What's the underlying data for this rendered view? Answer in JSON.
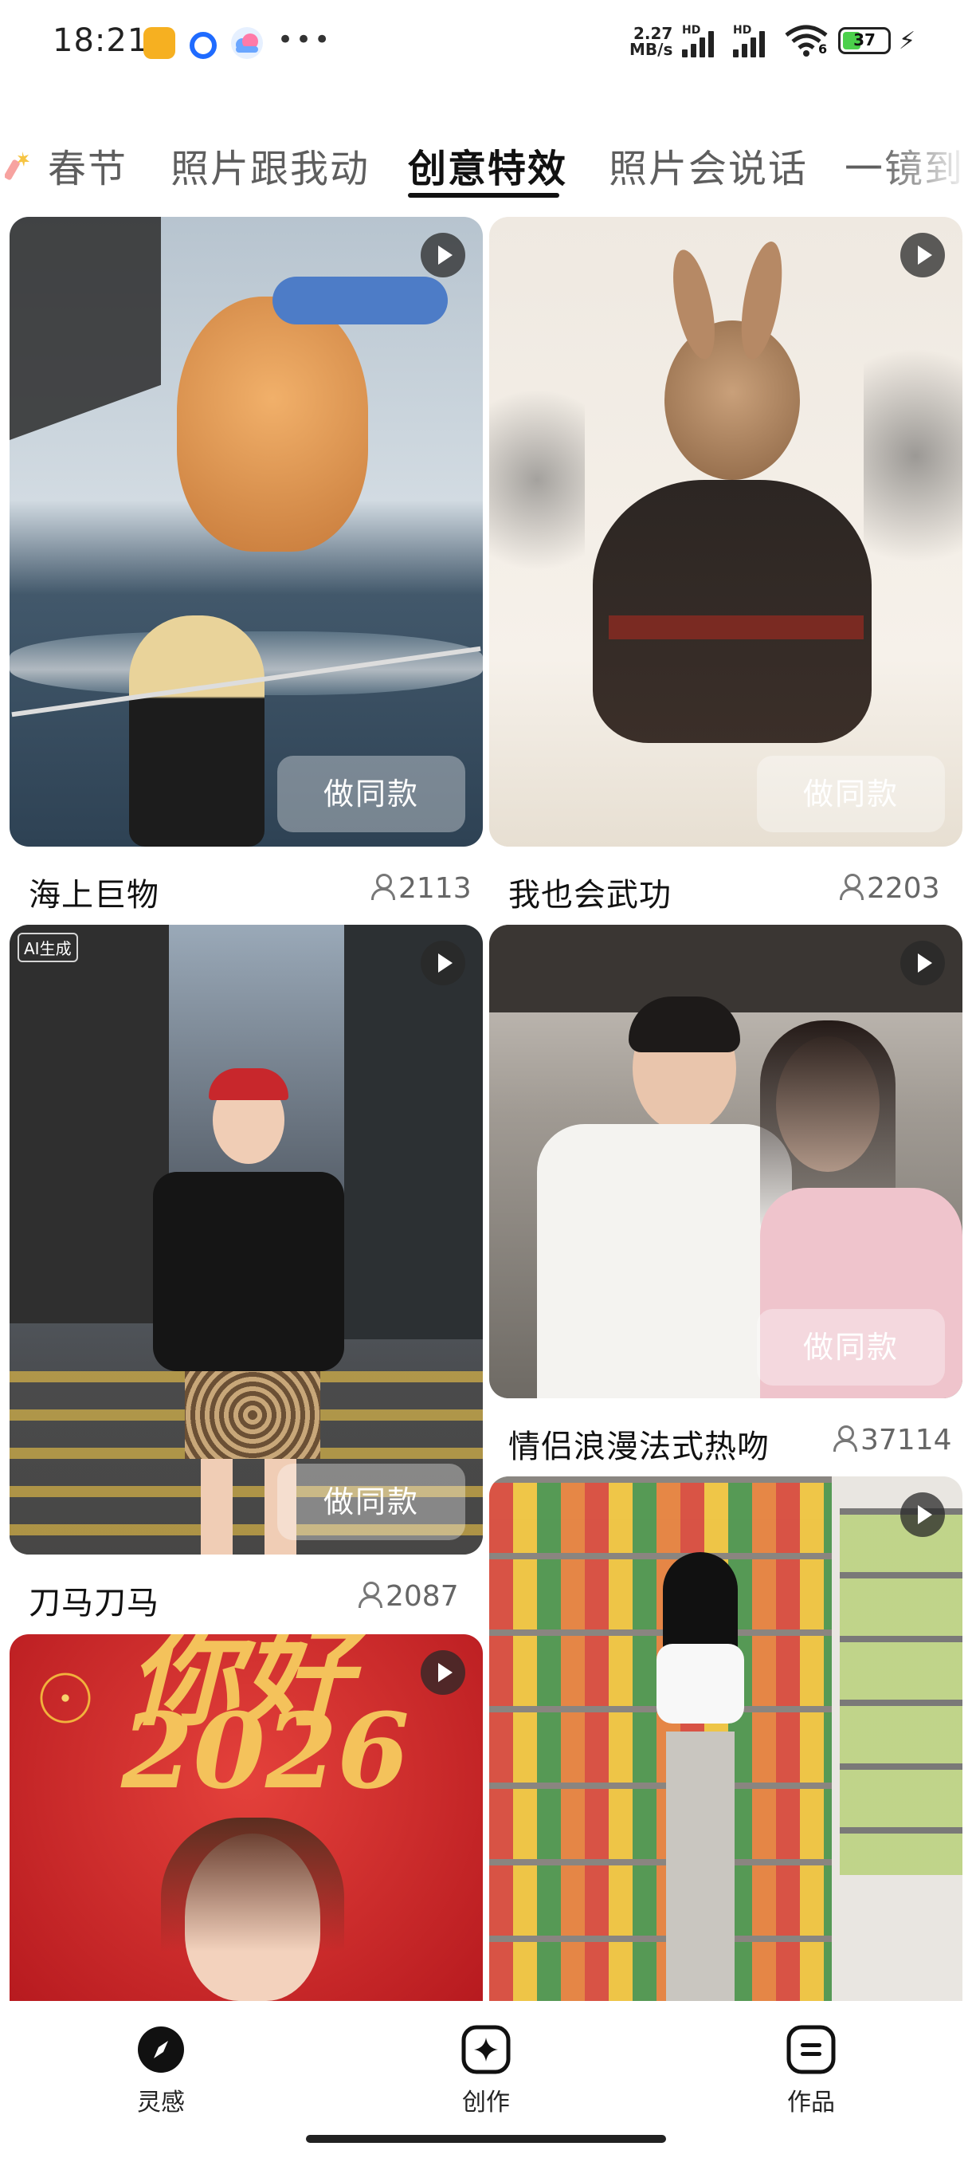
{
  "status_bar": {
    "time": "18:21",
    "network_speed_value": "2.27",
    "network_speed_unit": "MB/s",
    "hd1": "HD",
    "hd2": "HD",
    "wifi_label": "6",
    "battery_percent": "37"
  },
  "tabs": [
    {
      "label": "春节",
      "active": false
    },
    {
      "label": "照片跟我动",
      "active": false
    },
    {
      "label": "创意特效",
      "active": true
    },
    {
      "label": "照片会说话",
      "active": false
    },
    {
      "label": "一镜到",
      "active": false
    }
  ],
  "same_button_label": "做同款",
  "ai_tag": "AI生成",
  "cards": [
    {
      "title": "海上巨物",
      "count": "2113",
      "has_button": true
    },
    {
      "title": "我也会武功",
      "count": "2203",
      "has_button": true
    },
    {
      "title": "刀马刀马",
      "count": "2087",
      "has_button": true
    },
    {
      "title": "情侣浪漫法式热吻",
      "count": "37114",
      "has_button": true
    },
    {
      "banner_text_line1": "你好",
      "banner_text_line2": "2026"
    },
    {}
  ],
  "bottom_nav": [
    {
      "label": "灵感",
      "icon": "compass-icon",
      "active": true
    },
    {
      "label": "创作",
      "icon": "sparkle-create-icon",
      "active": false
    },
    {
      "label": "作品",
      "icon": "works-icon",
      "active": false
    }
  ],
  "colors": {
    "accent": "#111111",
    "battery": "#4bd04b",
    "banner_red": "#d3272b",
    "gold": "#f4c25b"
  }
}
